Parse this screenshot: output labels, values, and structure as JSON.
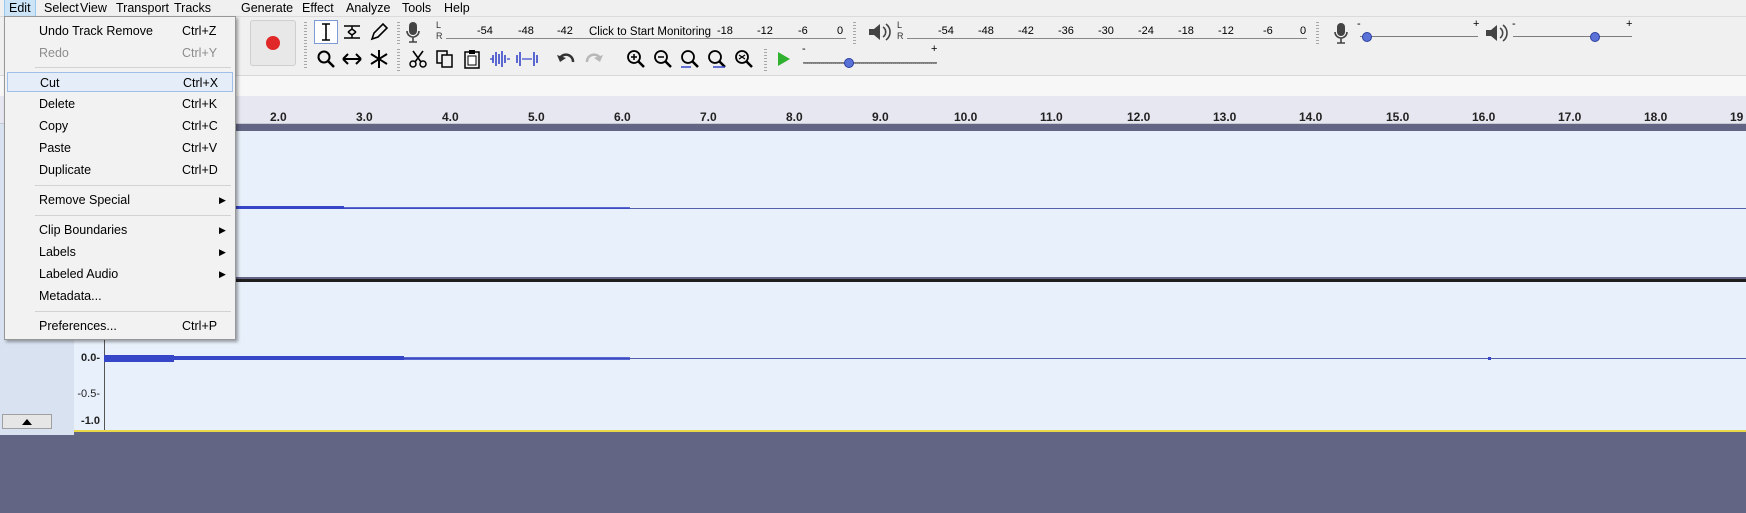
{
  "menubar": [
    "Edit",
    "Select",
    "View",
    "Transport",
    "Tracks",
    "Generate",
    "Effect",
    "Analyze",
    "Tools",
    "Help"
  ],
  "edit_menu": {
    "items": [
      {
        "label": "Undo Track Remove",
        "shortcut": "Ctrl+Z"
      },
      {
        "label": "Redo",
        "shortcut": "Ctrl+Y"
      },
      {
        "label": "Cut",
        "shortcut": "Ctrl+X"
      },
      {
        "label": "Delete",
        "shortcut": "Ctrl+K"
      },
      {
        "label": "Copy",
        "shortcut": "Ctrl+C"
      },
      {
        "label": "Paste",
        "shortcut": "Ctrl+V"
      },
      {
        "label": "Duplicate",
        "shortcut": "Ctrl+D"
      },
      {
        "label": "Remove Special",
        "shortcut": ""
      },
      {
        "label": "Clip Boundaries",
        "shortcut": ""
      },
      {
        "label": "Labels",
        "shortcut": ""
      },
      {
        "label": "Labeled Audio",
        "shortcut": ""
      },
      {
        "label": "Metadata...",
        "shortcut": ""
      },
      {
        "label": "Preferences...",
        "shortcut": "Ctrl+P"
      }
    ]
  },
  "record_meter": {
    "ticks": [
      "-54",
      "-48",
      "-42",
      "-18",
      "-12",
      "-6",
      "0"
    ],
    "monitor_text": "Click to Start Monitoring",
    "l": "L",
    "r": "R"
  },
  "play_meter": {
    "ticks": [
      "-54",
      "-48",
      "-42",
      "-36",
      "-30",
      "-24",
      "-18",
      "-12",
      "-6",
      "0"
    ],
    "l": "L",
    "r": "R"
  },
  "mixer": {
    "minus": "-",
    "plus": "+"
  },
  "timeline": {
    "labels": [
      "2.0",
      "3.0",
      "4.0",
      "5.0",
      "6.0",
      "7.0",
      "8.0",
      "9.0",
      "10.0",
      "11.0",
      "12.0",
      "13.0",
      "14.0",
      "15.0",
      "16.0",
      "17.0",
      "18.0",
      "19"
    ]
  },
  "track2_scale": [
    "0.0-",
    "-0.5-",
    "-1.0"
  ],
  "colors": {
    "menu_highlight": "#cce4f7",
    "wave": "#3646c8",
    "record": "#e02828",
    "background": "#636584"
  }
}
